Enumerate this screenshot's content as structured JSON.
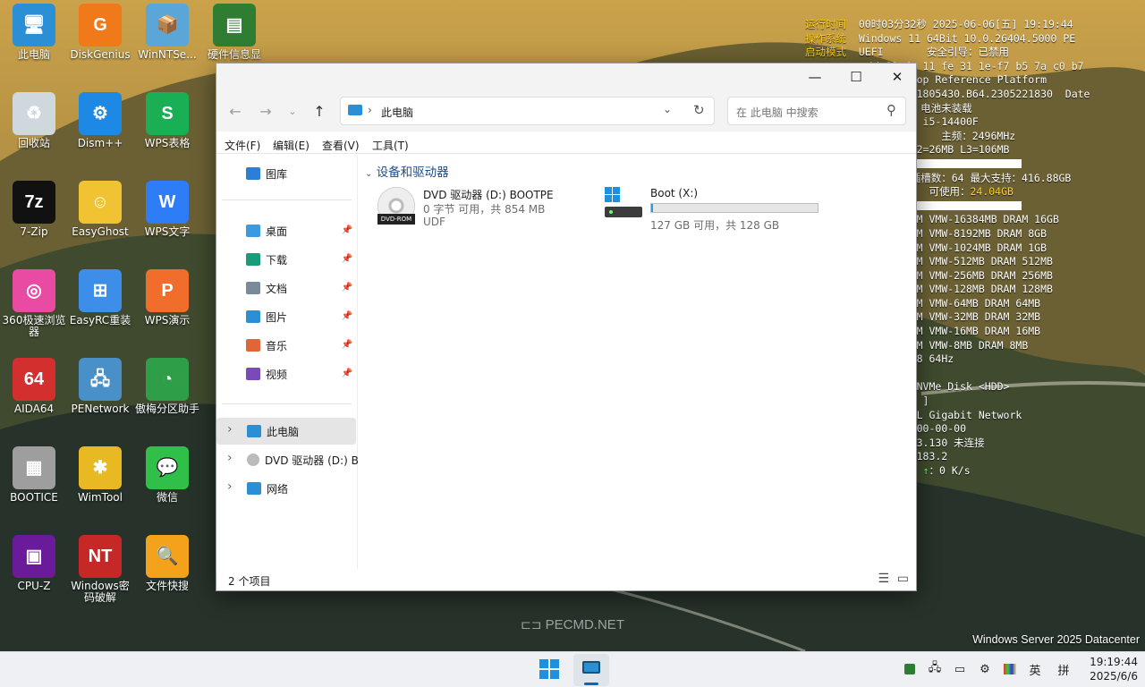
{
  "desktop_icons": [
    {
      "label": "此电脑",
      "icon": "computer-icon",
      "color": "#2b8fd6"
    },
    {
      "label": "DiskGenius",
      "icon": "diskgenius-icon",
      "color": "#f07a1a"
    },
    {
      "label": "WinNTSe...",
      "icon": "winntsetup-icon",
      "color": "#5aa6d8"
    },
    {
      "label": "硬件信息显",
      "icon": "hardware-info-icon",
      "color": "#2e7d32"
    },
    {
      "label": "回收站",
      "icon": "recycle-bin-icon",
      "color": "#cfd8dc"
    },
    {
      "label": "Dism++",
      "icon": "dism-gear-icon",
      "color": "#1e88e5"
    },
    {
      "label": "WPS表格",
      "icon": "wps-sheet-icon",
      "color": "#1aae55"
    },
    {
      "label": "7-Zip",
      "icon": "7zip-icon",
      "color": "#111111"
    },
    {
      "label": "EasyGhost",
      "icon": "easyghost-icon",
      "color": "#f1c232"
    },
    {
      "label": "WPS文字",
      "icon": "wps-writer-icon",
      "color": "#2f7df6"
    },
    {
      "label": "360极速浏览器",
      "icon": "360-browser-icon",
      "color": "#e94ba3"
    },
    {
      "label": "EasyRC重装",
      "icon": "easyrc-icon",
      "color": "#3d8ee8"
    },
    {
      "label": "WPS演示",
      "icon": "wps-present-icon",
      "color": "#f16d2b"
    },
    {
      "label": "AIDA64",
      "icon": "aida64-icon",
      "color": "#d32f2f"
    },
    {
      "label": "PENetwork",
      "icon": "penetwork-icon",
      "color": "#4a90c8"
    },
    {
      "label": "傲梅分区助手",
      "icon": "aomei-partition-icon",
      "color": "#2e9e48"
    },
    {
      "label": "BOOTICE",
      "icon": "bootice-icon",
      "color": "#9e9e9e"
    },
    {
      "label": "WimTool",
      "icon": "wimtool-icon",
      "color": "#e8b923"
    },
    {
      "label": "微信",
      "icon": "wechat-icon",
      "color": "#30c04a"
    },
    {
      "label": "CPU-Z",
      "icon": "cpuz-icon",
      "color": "#6a1b9a"
    },
    {
      "label": "Windows密码破解",
      "icon": "windows-password-icon",
      "color": "#c62828"
    },
    {
      "label": "文件快搜",
      "icon": "file-search-icon",
      "color": "#f4a21b"
    }
  ],
  "icon_glyphs": [
    "🖥",
    "G",
    "📦",
    "▤",
    "♻",
    "⚙",
    "S",
    "7z",
    "☺",
    "W",
    "◎",
    "⊞",
    "P",
    "64",
    "🖧",
    "◔",
    "▦",
    "✱",
    "💬",
    "▣",
    "NT",
    "🔍"
  ],
  "sysinfo": [
    [
      "运行时间",
      "00时03分32秒 2025-06-06[五] 19:19:44"
    ],
    [
      "操作系统",
      "Windows 11 64Bit 10.0.26404.5000 PE"
    ],
    [
      "启动模式",
      "UEFI       安全引导：已禁用"
    ],
    [
      "",
      "          4d 89 dc 11 fe 31 1e-f7 b5 7a c0 b7"
    ],
    [
      "",
      "          BX Desktop Reference Platform"
    ],
    [
      "",
      "          01.00V.21805430.B64.2305221830  Date"
    ],
    [
      "",
      "          接  电量：电池未装载"
    ],
    [
      "",
      "          Core(TM) i5-14400F"
    ],
    [
      "",
      "          线程：       主频：2496MHz"
    ],
    [
      "",
      "          L1=7MB L2=26MB L3=106MB"
    ]
  ],
  "sysinfo_extra": {
    "cpu_pct": "2 %",
    "cpu_fill": 0.02,
    "mem_line": "5.99GB 插槽数：64 最大支持：416.88GB",
    "mem_used": "95GB",
    "mem_avail_label": "可使用：",
    "mem_avail": "24.04GB",
    "mem_pct": "5 %",
    "mem_fill": 0.05,
    "ram_lines": [
      "rtual RAM VMW-16384MB DRAM 16GB",
      "rtual RAM VMW-8192MB DRAM 8GB",
      "rtual RAM VMW-1024MB DRAM 1GB",
      "rtual RAM VMW-512MB DRAM 512MB",
      "rtual RAM VMW-256MB DRAM 256MB",
      "rtual RAM VMW-128MB DRAM 128MB",
      "rtual RAM VMW-64MB DRAM 64MB",
      "rtual RAM VMW-32MB DRAM 32MB",
      "rtual RAM VMW-16MB DRAM 16MB",
      "rtual RAM VMW-8MB DRAM 8MB"
    ],
    "display_lines": [
      "280 x 768 64Hz",
      "SVGA 3D"
    ],
    "disk_lines": [
      "Virtual NVMe Disk <HDD>",
      "BR 2G [  ]"
    ],
    "net_lines": [
      "R) 82574L Gigabit Network",
      "0-00-00-00-00-00",
      "2.168.183.130 未连接",
      "192.168.183.2"
    ],
    "speed_down": "/s",
    "speed_up": "↑：0 K/s"
  },
  "watermark": "PECMD.NET",
  "os_edition": "Windows Server 2025 Datacenter",
  "explorer": {
    "window_controls": {
      "minimize": "—",
      "maximize": "☐",
      "close": "✕"
    },
    "address_text": "此电脑",
    "search_placeholder": "在 此电脑 中搜索",
    "menus": [
      "文件(F)",
      "编辑(E)",
      "查看(V)",
      "工具(T)"
    ],
    "sidebar": [
      {
        "label": "图库",
        "icon": "gallery-icon",
        "color": "#2b7fd6",
        "pinned": false
      },
      {
        "label": "桌面",
        "icon": "desktop-folder-icon",
        "color": "#3a9be0",
        "pinned": true
      },
      {
        "label": "下载",
        "icon": "download-icon",
        "color": "#1a9b7a",
        "pinned": true
      },
      {
        "label": "文档",
        "icon": "documents-icon",
        "color": "#7a8a9a",
        "pinned": true
      },
      {
        "label": "图片",
        "icon": "pictures-icon",
        "color": "#2b8fd6",
        "pinned": true
      },
      {
        "label": "音乐",
        "icon": "music-icon",
        "color": "#e0663a",
        "pinned": true
      },
      {
        "label": "视频",
        "icon": "videos-icon",
        "color": "#7a4ab8",
        "pinned": true
      },
      {
        "label": "此电脑",
        "icon": "this-pc-icon",
        "color": "#2b8fd6",
        "pinned": false,
        "selected": true
      },
      {
        "label": "DVD 驱动器 (D:) B",
        "icon": "dvd-drive-icon",
        "color": "#bbbbbb",
        "pinned": false
      },
      {
        "label": "网络",
        "icon": "network-icon",
        "color": "#2b8fd6",
        "pinned": false
      }
    ],
    "section_title": "设备和驱动器",
    "drives": [
      {
        "name": "DVD 驱动器 (D:) BOOTPE",
        "line2": "0 字节 可用，共 854 MB",
        "line3": "UDF",
        "badge": "DVD-ROM",
        "used_fill": null
      },
      {
        "name": "Boot (X:)",
        "line2": "127 GB 可用，共 128 GB",
        "line3": "",
        "badge": "",
        "used_fill": 0.01
      }
    ],
    "status_text": "2 个项目"
  },
  "taskbar": {
    "clock_time": "19:19:44",
    "clock_date": "2025/6/6",
    "ime_lang": "英",
    "ime_mode": "拼"
  }
}
